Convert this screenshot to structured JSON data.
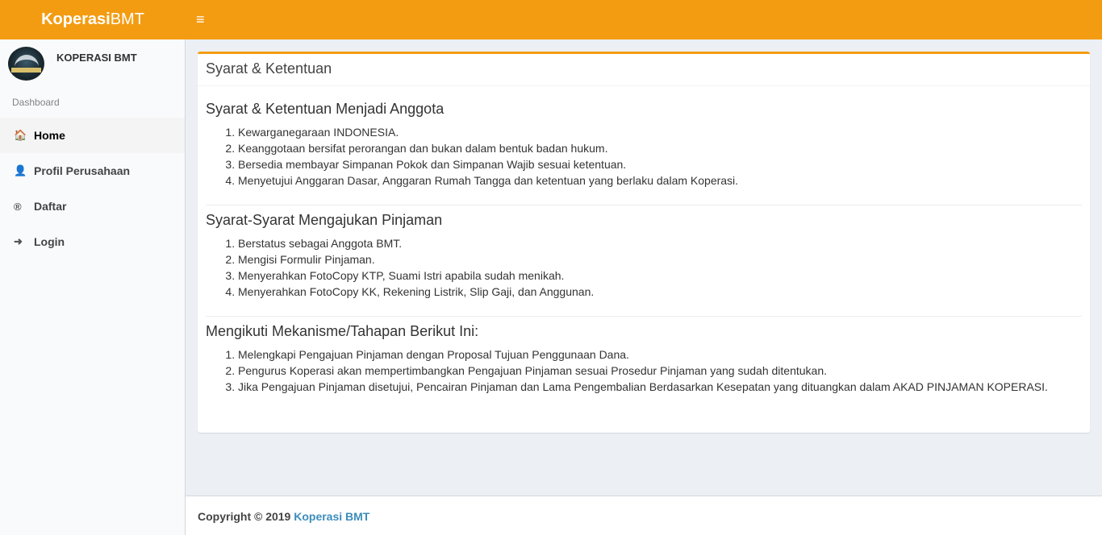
{
  "app": {
    "brand_bold": "Koperasi",
    "brand_rest": "BMT",
    "menu_toggle": "≡"
  },
  "user_panel": {
    "name": "KOPERASI BMT"
  },
  "sidebar": {
    "header": "Dashboard",
    "items": [
      {
        "label": "Home",
        "icon": "home-icon",
        "glyph": "🏠",
        "active": true
      },
      {
        "label": "Profil Perusahaan",
        "icon": "user-icon",
        "glyph": "👤",
        "active": false
      },
      {
        "label": "Daftar",
        "icon": "registered-icon",
        "glyph": "®",
        "active": false
      },
      {
        "label": "Login",
        "icon": "sign-in-icon",
        "glyph": "➜",
        "active": false
      }
    ]
  },
  "main": {
    "box_title": "Syarat & Ketentuan",
    "sections": [
      {
        "title": "Syarat & Ketentuan Menjadi Anggota",
        "items": [
          "Kewarganegaraan INDONESIA.",
          "Keanggotaan bersifat perorangan dan bukan dalam bentuk badan hukum.",
          "Bersedia membayar Simpanan Pokok dan Simpanan Wajib sesuai ketentuan.",
          "Menyetujui Anggaran Dasar, Anggaran Rumah Tangga dan ketentuan yang berlaku dalam Koperasi."
        ]
      },
      {
        "title": "Syarat-Syarat Mengajukan Pinjaman",
        "items": [
          "Berstatus sebagai Anggota BMT.",
          "Mengisi Formulir Pinjaman.",
          "Menyerahkan FotoCopy KTP, Suami Istri apabila sudah menikah.",
          "Menyerahkan FotoCopy KK, Rekening Listrik, Slip Gaji, dan Anggunan."
        ]
      },
      {
        "title": "Mengikuti Mekanisme/Tahapan Berikut Ini:",
        "items": [
          "Melengkapi Pengajuan Pinjaman dengan Proposal Tujuan Penggunaan Dana.",
          "Pengurus Koperasi akan mempertimbangkan Pengajuan Pinjaman sesuai Prosedur Pinjaman yang sudah ditentukan.",
          "Jika Pengajuan Pinjaman disetujui, Pencairan Pinjaman dan Lama Pengembalian Berdasarkan Kesepatan yang dituangkan dalam AKAD PINJAMAN KOPERASI."
        ]
      }
    ]
  },
  "footer": {
    "copyright": "Copyright © 2019",
    "link": "Koperasi BMT"
  },
  "colors": {
    "accent": "#f39c12",
    "link": "#3c8dbc",
    "background": "#ecf0f5"
  }
}
